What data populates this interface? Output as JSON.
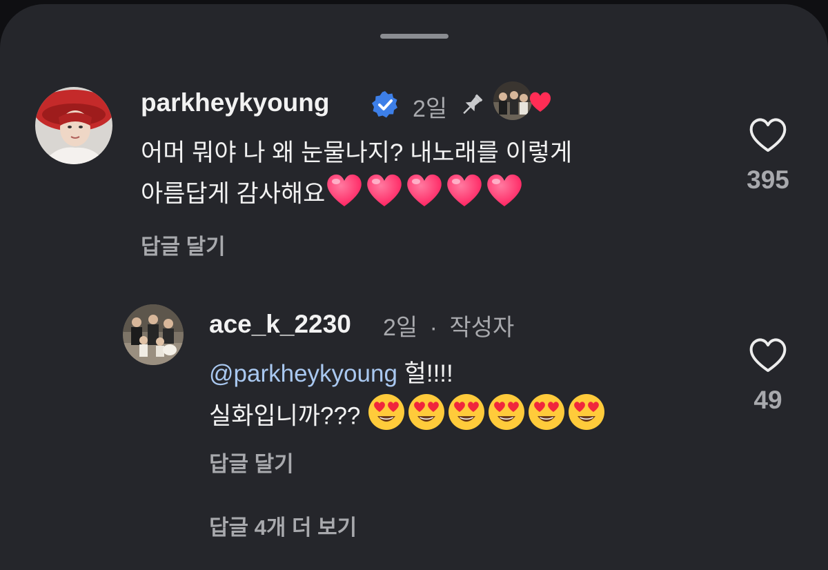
{
  "comments": [
    {
      "username": "parkheykyoung",
      "verified": true,
      "time": "2일",
      "pinned": true,
      "liked_by_author": true,
      "text_line1": "어머 뭐야 나 왜 눈물나지? 내노래를 이렇게",
      "text_line2": "아름답게  감사해요",
      "emoji": "heart-emoji",
      "emoji_count": 5,
      "reply_label": "답글 달기",
      "likes": "395"
    },
    {
      "username": "ace_k_2230",
      "time": "2일",
      "separator": "·",
      "author_badge": "작성자",
      "mention": "@parkheykyoung",
      "text_line1_suffix": " 헐!!!!",
      "text_line2": "실화입니까??? ",
      "emoji": "heart-eyes-emoji",
      "emoji_count": 6,
      "reply_label": "답글 달기",
      "likes": "49"
    }
  ],
  "more_replies_label": "답글 4개 더 보기",
  "colors": {
    "background": "#25262b",
    "primary_text": "#f2f2f2",
    "secondary_text": "#a8a9ad",
    "mention": "#a9c8f0",
    "verified_badge": "#3d7fe8",
    "heart": "#ff2d5a"
  }
}
